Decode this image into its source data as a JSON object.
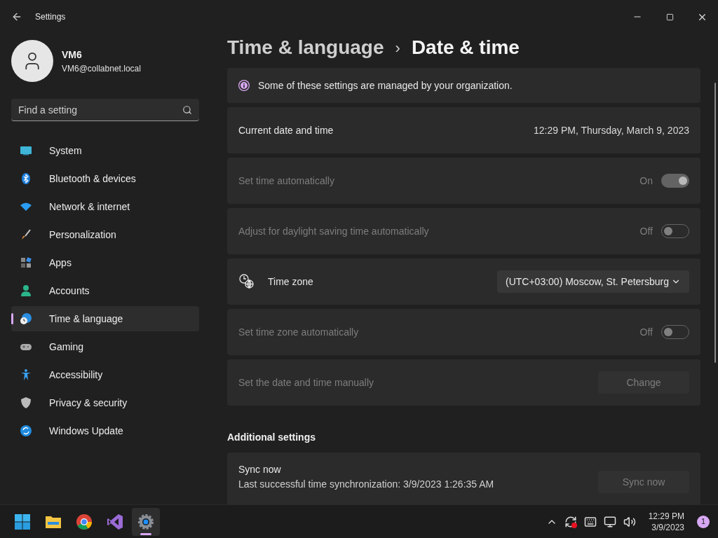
{
  "window": {
    "title": "Settings"
  },
  "user": {
    "name": "VM6",
    "email": "VM6@collabnet.local"
  },
  "search": {
    "placeholder": "Find a setting"
  },
  "sidebar": {
    "items": [
      {
        "label": "System",
        "kind": "system",
        "selected": false
      },
      {
        "label": "Bluetooth & devices",
        "kind": "bluetooth",
        "selected": false
      },
      {
        "label": "Network & internet",
        "kind": "network",
        "selected": false
      },
      {
        "label": "Personalization",
        "kind": "brush",
        "selected": false
      },
      {
        "label": "Apps",
        "kind": "apps",
        "selected": false
      },
      {
        "label": "Accounts",
        "kind": "accounts",
        "selected": false
      },
      {
        "label": "Time & language",
        "kind": "time",
        "selected": true
      },
      {
        "label": "Gaming",
        "kind": "gaming",
        "selected": false
      },
      {
        "label": "Accessibility",
        "kind": "accessibility",
        "selected": false
      },
      {
        "label": "Privacy & security",
        "kind": "shield",
        "selected": false
      },
      {
        "label": "Windows Update",
        "kind": "update",
        "selected": false
      }
    ]
  },
  "breadcrumb": {
    "parent": "Time & language",
    "separator": "›",
    "current": "Date & time"
  },
  "settings": [
    {
      "kind": "info",
      "label": "Some of these settings are managed by your organization."
    },
    {
      "kind": "value",
      "label": "Current date and time",
      "value": "12:29 PM, Thursday, March 9, 2023",
      "disabled": false
    },
    {
      "kind": "toggle",
      "label": "Set time automatically",
      "state_text": "On",
      "on": true,
      "disabled": true
    },
    {
      "kind": "toggle",
      "label": "Adjust for daylight saving time automatically",
      "state_text": "Off",
      "on": false,
      "disabled": true
    },
    {
      "kind": "dropdown",
      "label": "Time zone",
      "value": "(UTC+03:00) Moscow, St. Petersburg",
      "disabled": false
    },
    {
      "kind": "toggle",
      "label": "Set time zone automatically",
      "state_text": "Off",
      "on": false,
      "disabled": true
    },
    {
      "kind": "button",
      "label": "Set the date and time manually",
      "button": "Change",
      "disabled": true
    }
  ],
  "additional": {
    "heading": "Additional settings",
    "sync": {
      "title": "Sync now",
      "detail": "Last successful time synchronization: 3/9/2023 1:26:35 AM",
      "button": "Sync now",
      "disabled": true
    }
  },
  "taskbar": {
    "apps": [
      {
        "kind": "start",
        "selected": false
      },
      {
        "kind": "explorer",
        "selected": false
      },
      {
        "kind": "chrome",
        "selected": false
      },
      {
        "kind": "vs",
        "selected": false
      },
      {
        "kind": "settings",
        "selected": true
      }
    ],
    "time": "12:29 PM",
    "date": "3/9/2023",
    "notification_count": "1"
  }
}
